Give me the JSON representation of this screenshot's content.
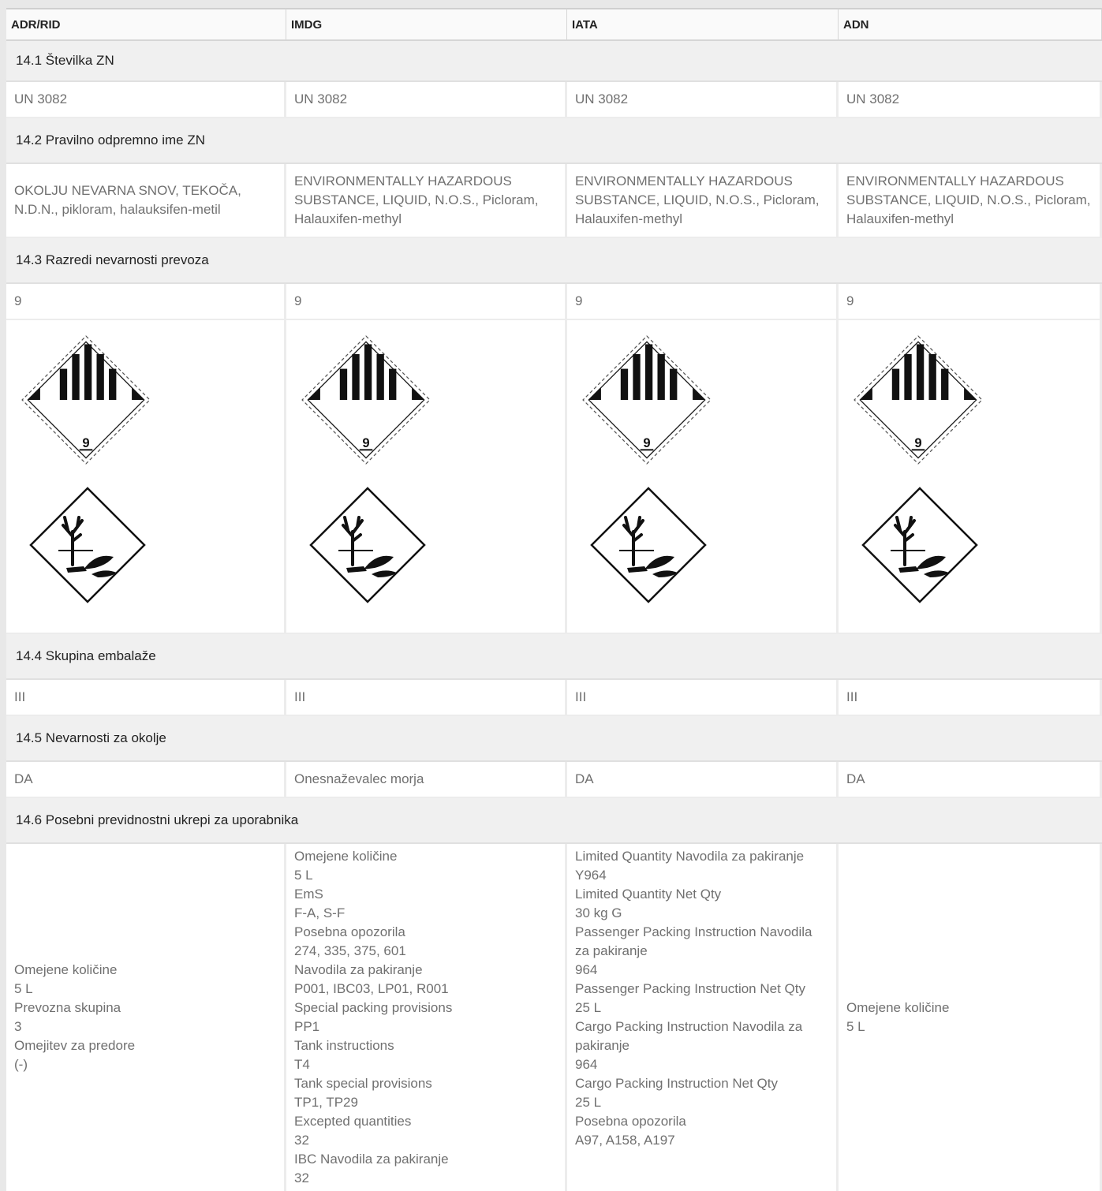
{
  "headers": [
    "ADR/RID",
    "IMDG",
    "IATA",
    "ADN"
  ],
  "sections": {
    "un_number": {
      "title": "14.1 Številka ZN",
      "values": [
        "UN 3082",
        "UN 3082",
        "UN 3082",
        "UN 3082"
      ]
    },
    "shipping_name": {
      "title": "14.2 Pravilno odpremno ime ZN",
      "values": [
        "OKOLJU NEVARNA SNOV, TEKOČA, N.D.N., pikloram, halauksifen-metil",
        "ENVIRONMENTALLY HAZARDOUS SUBSTANCE, LIQUID, N.O.S., Picloram, Halauxifen-methyl",
        "ENVIRONMENTALLY HAZARDOUS SUBSTANCE, LIQUID, N.O.S., Picloram, Halauxifen-methyl",
        "ENVIRONMENTALLY HAZARDOUS SUBSTANCE, LIQUID, N.O.S., Picloram, Halauxifen-methyl"
      ]
    },
    "hazard_class": {
      "title": "14.3 Razredi nevarnosti prevoza",
      "values": [
        "9",
        "9",
        "9",
        "9"
      ],
      "label_number": "9",
      "pictograms": [
        "class-9-hazard-label-icon",
        "environmental-hazard-icon"
      ]
    },
    "packing_group": {
      "title": "14.4 Skupina embalaže",
      "values": [
        "III",
        "III",
        "III",
        "III"
      ]
    },
    "environment": {
      "title": "14.5 Nevarnosti za okolje",
      "values": [
        "DA",
        "Onesnaževalec morja",
        "DA",
        "DA"
      ]
    },
    "precautions": {
      "title": "14.6 Posebni previdnostni ukrepi za uporabnika",
      "adr": [
        "Omejene količine",
        "5 L",
        "Prevozna skupina",
        "3",
        "Omejitev za predore",
        "(-)"
      ],
      "imdg": [
        "Omejene količine",
        "5 L",
        "EmS",
        "F-A, S-F",
        "Posebna opozorila",
        "274, 335, 375, 601",
        "Navodila za pakiranje",
        "P001, IBC03, LP01, R001",
        "Special packing provisions",
        "PP1",
        "Tank instructions",
        "T4",
        "Tank special provisions",
        "TP1, TP29",
        "Excepted quantities",
        "32",
        "IBC Navodila za pakiranje",
        "32"
      ],
      "iata": [
        "Limited Quantity Navodila za pakiranje",
        "Y964",
        "Limited Quantity Net Qty",
        "30 kg G",
        "Passenger Packing Instruction Navodila za pakiranje",
        "964",
        "Passenger Packing Instruction Net Qty",
        "25 L",
        "Cargo Packing Instruction Navodila za pakiranje",
        "964",
        "Cargo Packing Instruction Net Qty",
        "25 L",
        "Posebna opozorila",
        "A97, A158, A197"
      ],
      "adn": [
        "Omejene količine",
        "5 L"
      ]
    }
  }
}
